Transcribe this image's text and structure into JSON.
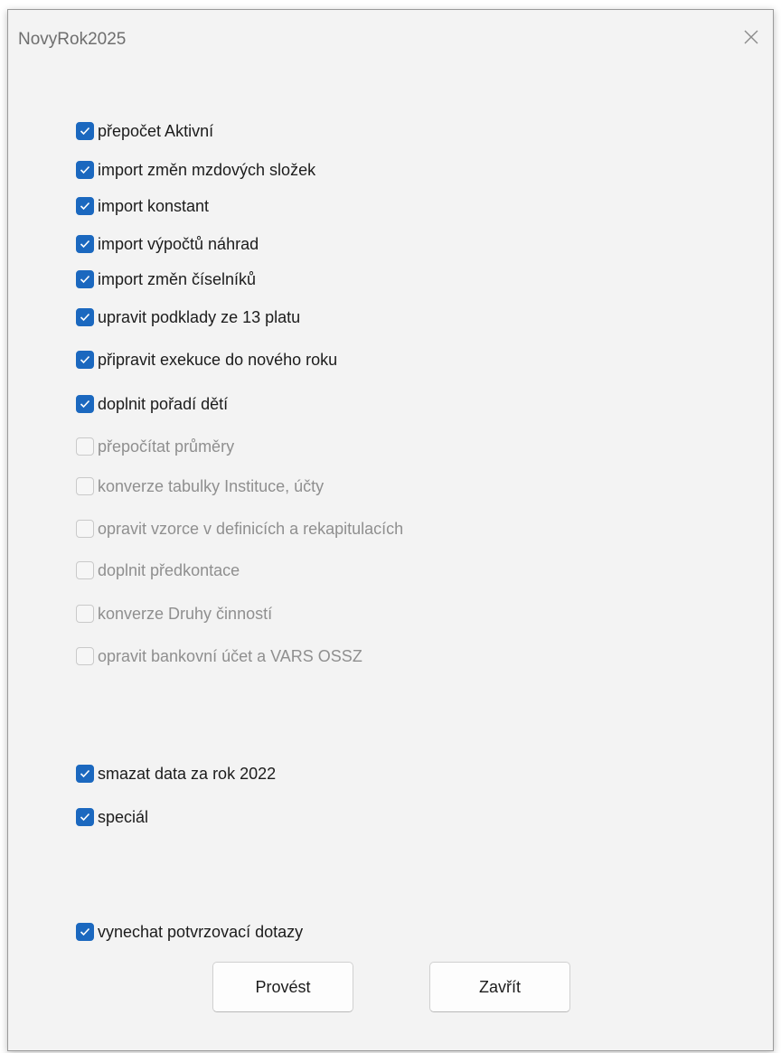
{
  "window": {
    "title": "NovyRok2025",
    "close_icon": "close-icon"
  },
  "options": [
    {
      "label": "přepočet Aktivní",
      "checked": true,
      "enabled": true
    },
    {
      "label": "import změn mzdových složek",
      "checked": true,
      "enabled": true
    },
    {
      "label": "import konstant",
      "checked": true,
      "enabled": true
    },
    {
      "label": "import výpočtů náhrad",
      "checked": true,
      "enabled": true
    },
    {
      "label": "import změn číselníků",
      "checked": true,
      "enabled": true
    },
    {
      "label": "upravit podklady ze 13 platu",
      "checked": true,
      "enabled": true
    },
    {
      "label": "připravit exekuce do nového roku",
      "checked": true,
      "enabled": true
    },
    {
      "label": "doplnit pořadí dětí",
      "checked": true,
      "enabled": true
    },
    {
      "label": "přepočítat průměry",
      "checked": false,
      "enabled": false
    },
    {
      "label": "konverze tabulky Instituce, účty",
      "checked": false,
      "enabled": false
    },
    {
      "label": "opravit vzorce v definicích a rekapitulacích",
      "checked": false,
      "enabled": false
    },
    {
      "label": "doplnit předkontace",
      "checked": false,
      "enabled": false
    },
    {
      "label": "konverze Druhy činností",
      "checked": false,
      "enabled": false
    },
    {
      "label": "opravit bankovní účet a VARS OSSZ",
      "checked": false,
      "enabled": false
    },
    {
      "label": "smazat data za rok 2022",
      "checked": true,
      "enabled": true
    },
    {
      "label": "speciál",
      "checked": true,
      "enabled": true
    },
    {
      "label": "vynechat potvrzovací dotazy",
      "checked": true,
      "enabled": true
    }
  ],
  "buttons": {
    "execute_label": "Provést",
    "close_label": "Zavřít"
  },
  "colors": {
    "accent": "#1b68bf",
    "disabled_text": "#8f8f8f",
    "background": "#f3f3f3"
  }
}
